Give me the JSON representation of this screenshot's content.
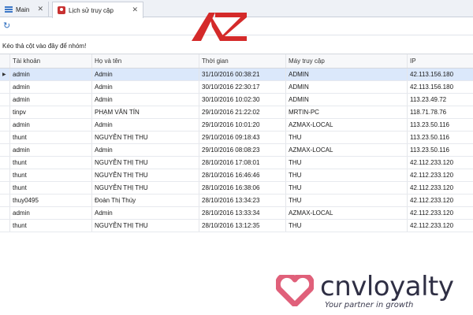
{
  "tabs": [
    {
      "label": "Main",
      "icon": "list-icon"
    },
    {
      "label": "Lịch sử truy cập",
      "icon": "user-icon",
      "active": true
    }
  ],
  "group_hint": "Kéo thả cột vào đây để nhóm!",
  "columns": [
    "Tài khoản",
    "Họ và tên",
    "Thời gian",
    "Máy truy cập",
    "IP"
  ],
  "rows": [
    {
      "account": "admin",
      "name": "Admin",
      "time": "31/10/2016 00:38:21",
      "machine": "ADMIN",
      "ip": "42.113.156.180",
      "selected": true
    },
    {
      "account": "admin",
      "name": "Admin",
      "time": "30/10/2016 22:30:17",
      "machine": "ADMIN",
      "ip": "42.113.156.180"
    },
    {
      "account": "admin",
      "name": "Admin",
      "time": "30/10/2016 10:02:30",
      "machine": "ADMIN",
      "ip": "113.23.49.72"
    },
    {
      "account": "tinpv",
      "name": "PHẠM VĂN TÍN",
      "time": "29/10/2016 21:22:02",
      "machine": "MRTIN-PC",
      "ip": "118.71.78.76"
    },
    {
      "account": "admin",
      "name": "Admin",
      "time": "29/10/2016 10:01:20",
      "machine": "AZMAX-LOCAL",
      "ip": "113.23.50.116"
    },
    {
      "account": "thunt",
      "name": "NGUYỄN THỊ THU",
      "time": "29/10/2016 09:18:43",
      "machine": "THU",
      "ip": "113.23.50.116"
    },
    {
      "account": "admin",
      "name": "Admin",
      "time": "29/10/2016 08:08:23",
      "machine": "AZMAX-LOCAL",
      "ip": "113.23.50.116"
    },
    {
      "account": "thunt",
      "name": "NGUYỄN THỊ THU",
      "time": "28/10/2016 17:08:01",
      "machine": "THU",
      "ip": "42.112.233.120"
    },
    {
      "account": "thunt",
      "name": "NGUYỄN THỊ THU",
      "time": "28/10/2016 16:46:46",
      "machine": "THU",
      "ip": "42.112.233.120"
    },
    {
      "account": "thunt",
      "name": "NGUYỄN THỊ THU",
      "time": "28/10/2016 16:38:06",
      "machine": "THU",
      "ip": "42.112.233.120"
    },
    {
      "account": "thuy0495",
      "name": "Đoàn Thị Thúy",
      "time": "28/10/2016 13:34:23",
      "machine": "THU",
      "ip": "42.112.233.120"
    },
    {
      "account": "admin",
      "name": "Admin",
      "time": "28/10/2016 13:33:34",
      "machine": "AZMAX-LOCAL",
      "ip": "42.112.233.120"
    },
    {
      "account": "thunt",
      "name": "NGUYỄN THỊ THU",
      "time": "28/10/2016 13:12:35",
      "machine": "THU",
      "ip": "42.112.233.120"
    }
  ],
  "selected_indicator": "▶",
  "watermark": {
    "brand": "cnvloyalty",
    "tagline": "Your partner in growth",
    "az_logo_color": "#d42a2a",
    "heart_color": "#e0607a"
  },
  "colors": {
    "selected_row": "#dbe8fb",
    "tab_icon_blue": "#3c78c8"
  }
}
